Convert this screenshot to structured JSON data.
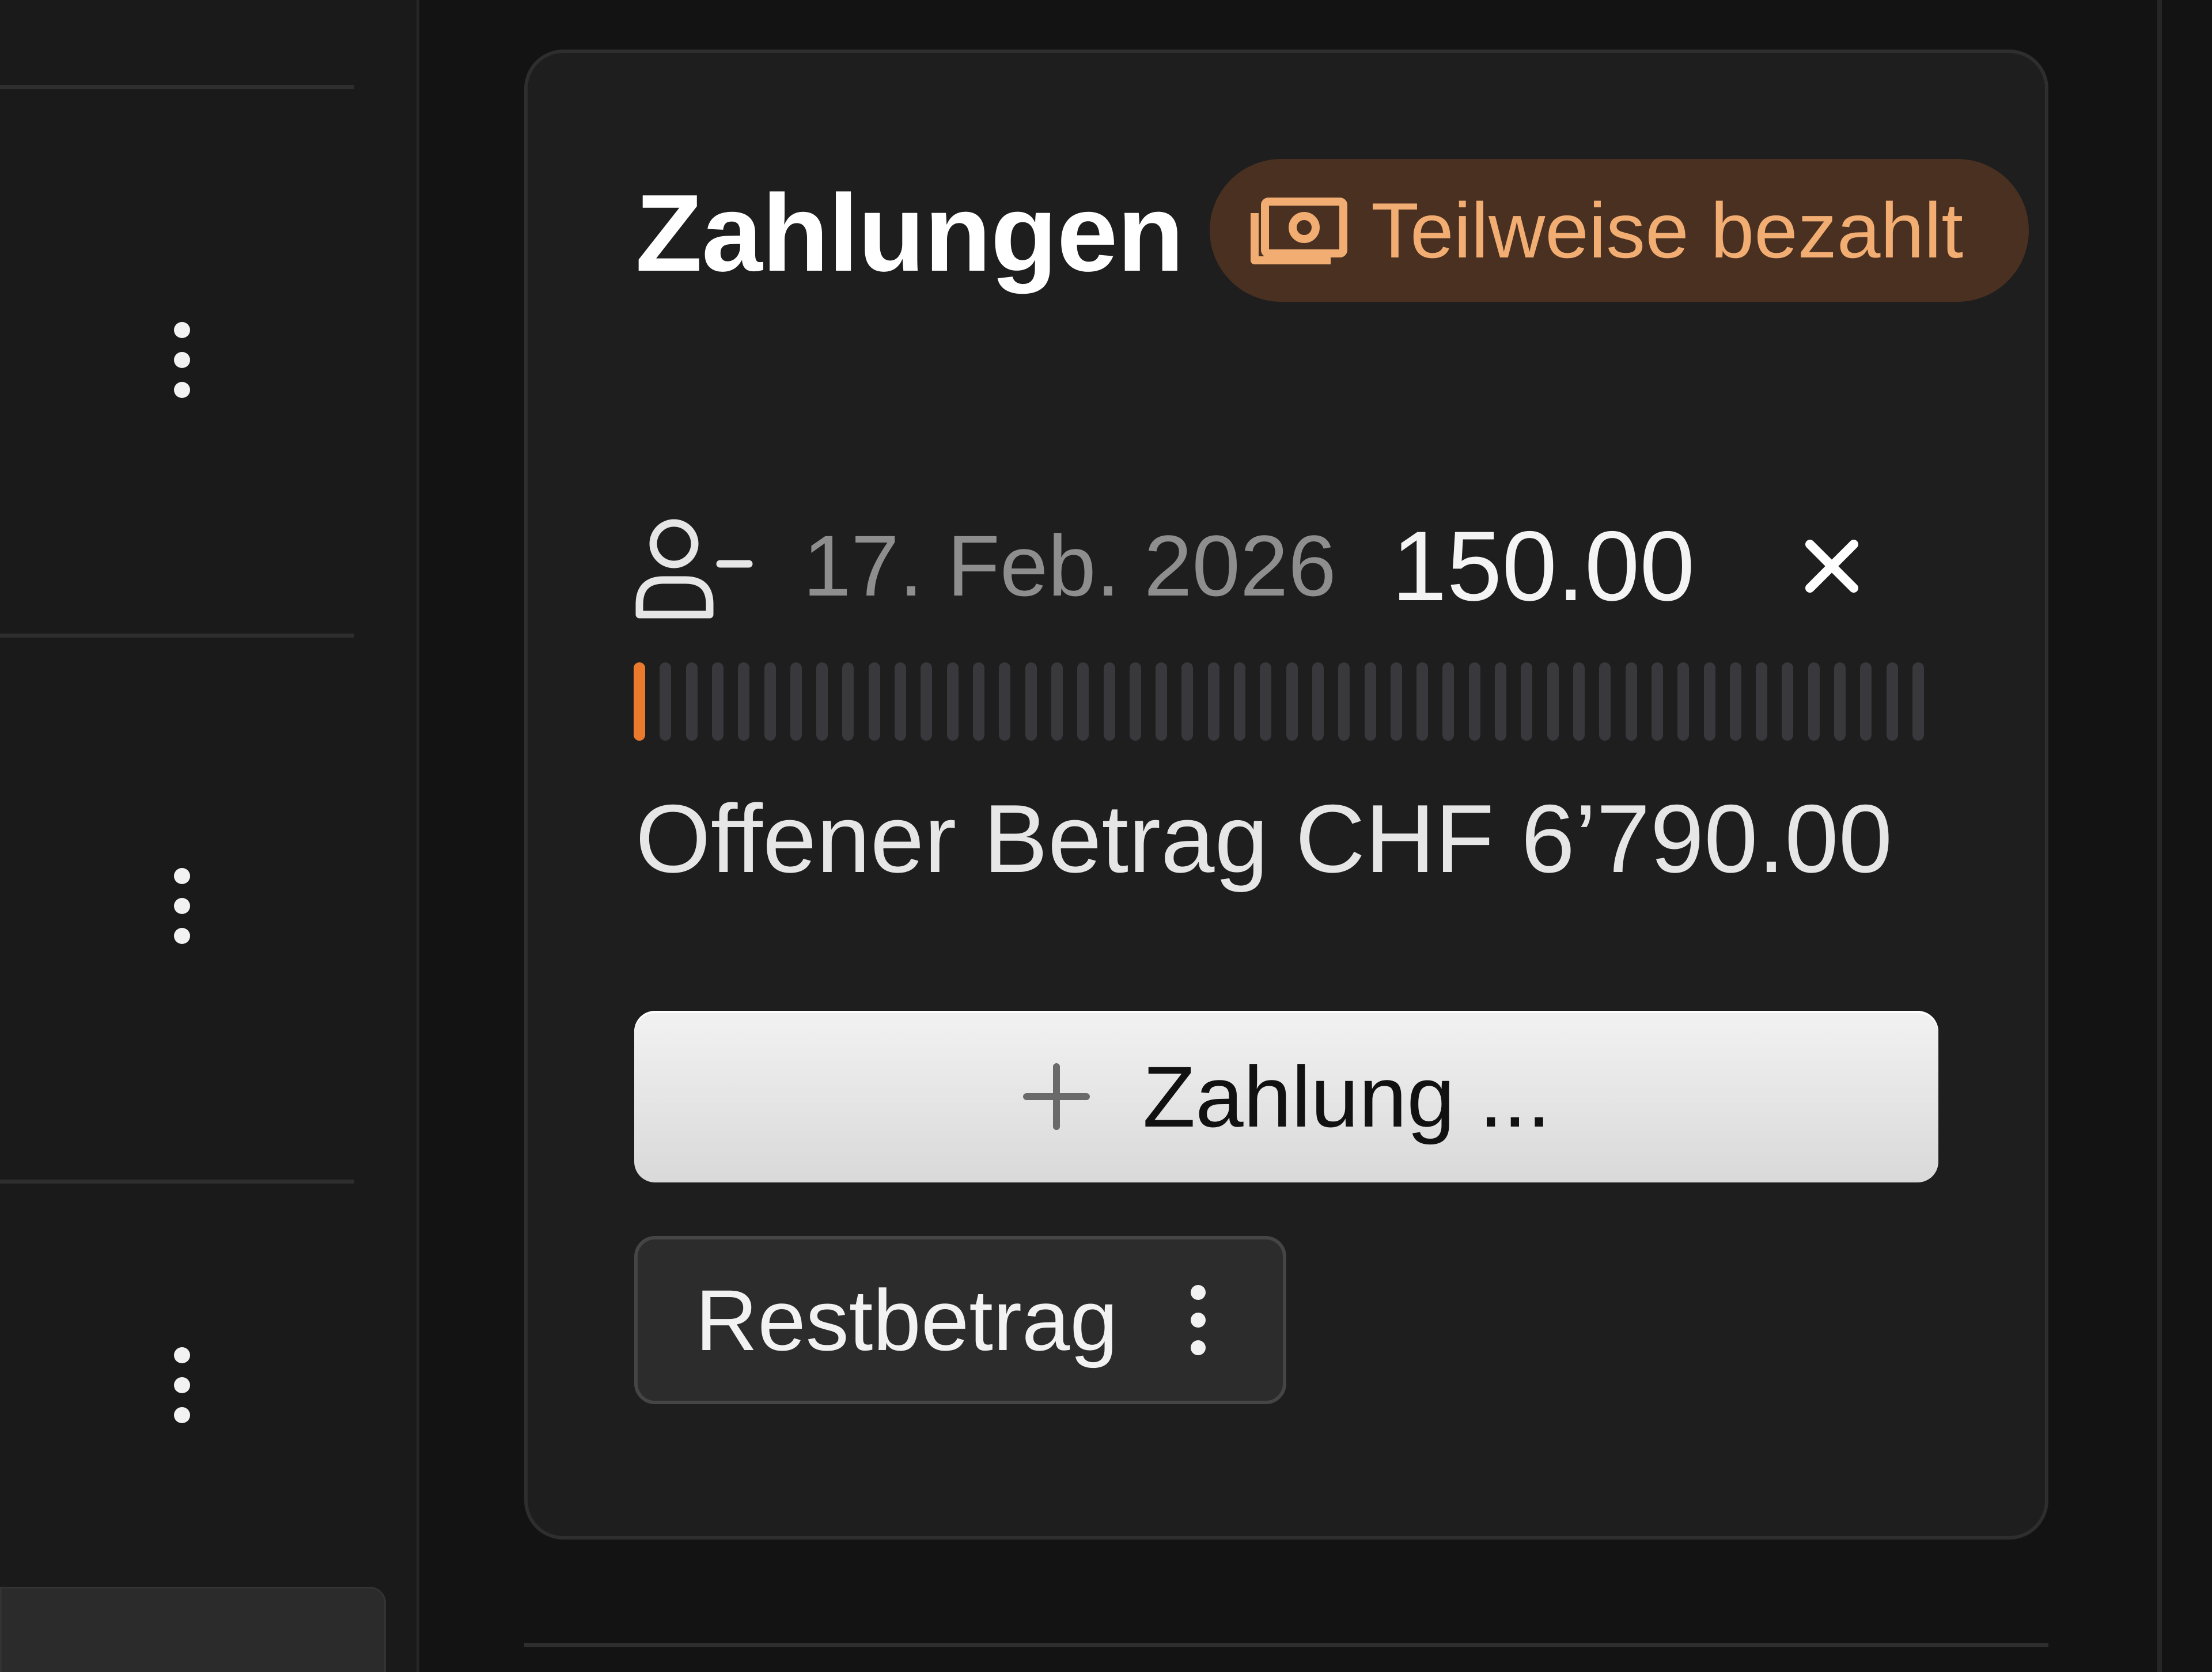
{
  "payments": {
    "title": "Zahlungen",
    "status": {
      "label": "Teilweise bezahlt",
      "icon": "banknote-icon",
      "text_color": "#f2ad72",
      "background": "#4a3020"
    },
    "entries": [
      {
        "icon": "person-minus-icon",
        "date": "17. Feb. 2026",
        "amount": "150.00",
        "remove_icon": "close-icon"
      }
    ],
    "progress": {
      "paid_fraction": 0.022,
      "fill_color": "#ec7a2d"
    },
    "open_amount_label": "Offener Betrag CHF 6’790.00",
    "add_payment_label": "Zahlung ...",
    "add_payment_icon": "plus-icon",
    "remaining_label": "Restbetrag",
    "remaining_menu_icon": "more-vertical-icon"
  },
  "left_list": {
    "row_menu_icon": "more-vertical-icon"
  }
}
